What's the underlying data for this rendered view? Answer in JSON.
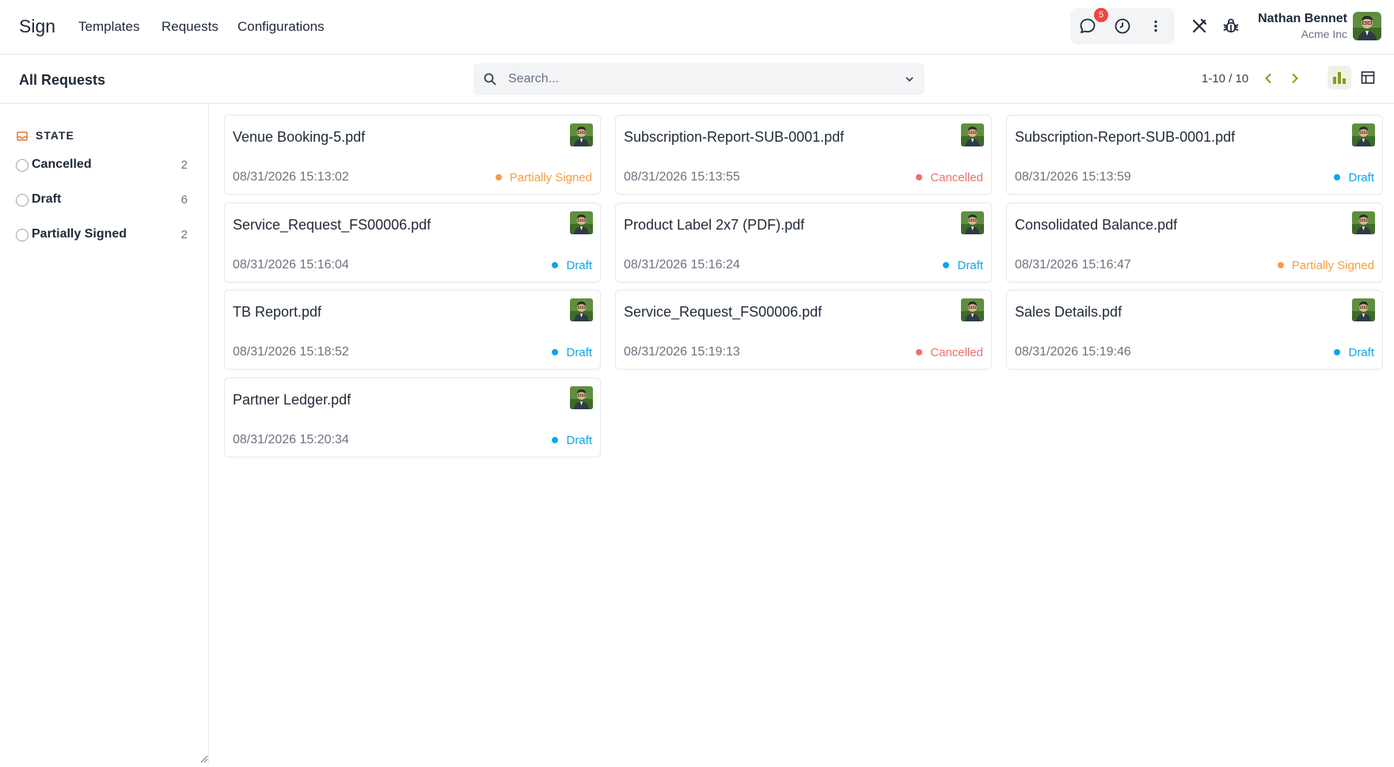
{
  "app": {
    "brand": "Sign",
    "nav": [
      "Templates",
      "Requests",
      "Configurations"
    ],
    "notifications_count": "5",
    "user": {
      "name": "Nathan Bennet",
      "company": "Acme Inc"
    }
  },
  "toolbar": {
    "title": "All Requests",
    "search_placeholder": "Search...",
    "pager": "1-10 / 10"
  },
  "sidebar": {
    "facet_title": "STATE",
    "items": [
      {
        "label": "Cancelled",
        "count": "2"
      },
      {
        "label": "Draft",
        "count": "6"
      },
      {
        "label": "Partially Signed",
        "count": "2"
      }
    ]
  },
  "cards": [
    {
      "title": "Venue Booking-5.pdf",
      "date": "08/31/2026 15:13:02",
      "status": "Partially Signed",
      "status_key": "partial"
    },
    {
      "title": "Subscription-Report-SUB-0001.pdf",
      "date": "08/31/2026 15:13:55",
      "status": "Cancelled",
      "status_key": "cancel"
    },
    {
      "title": "Subscription-Report-SUB-0001.pdf",
      "date": "08/31/2026 15:13:59",
      "status": "Draft",
      "status_key": "draft"
    },
    {
      "title": "Service_Request_FS00006.pdf",
      "date": "08/31/2026 15:16:04",
      "status": "Draft",
      "status_key": "draft"
    },
    {
      "title": "Product Label 2x7 (PDF).pdf",
      "date": "08/31/2026 15:16:24",
      "status": "Draft",
      "status_key": "draft"
    },
    {
      "title": "Consolidated Balance.pdf",
      "date": "08/31/2026 15:16:47",
      "status": "Partially Signed",
      "status_key": "partial"
    },
    {
      "title": "TB Report.pdf",
      "date": "08/31/2026 15:18:52",
      "status": "Draft",
      "status_key": "draft"
    },
    {
      "title": "Service_Request_FS00006.pdf",
      "date": "08/31/2026 15:19:13",
      "status": "Cancelled",
      "status_key": "cancel"
    },
    {
      "title": "Sales Details.pdf",
      "date": "08/31/2026 15:19:46",
      "status": "Draft",
      "status_key": "draft"
    },
    {
      "title": "Partner Ledger.pdf",
      "date": "08/31/2026 15:20:34",
      "status": "Draft",
      "status_key": "draft"
    }
  ],
  "colors": {
    "draft": "#0ea5e9",
    "cancelled": "#ef6f6c",
    "partially_signed": "#f59e42",
    "accent": "#8a9a1b"
  }
}
